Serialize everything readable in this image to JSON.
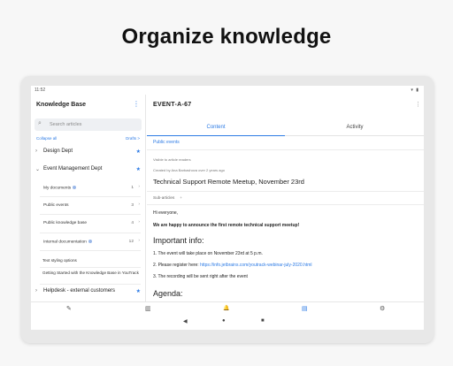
{
  "headline": "Organize knowledge",
  "status": {
    "time": "11:52",
    "icons": "▾ ▮"
  },
  "sidebar": {
    "title": "Knowledge Base",
    "menu_icon": "⋮",
    "search_placeholder": "Search articles",
    "collapse_all": "Collapse all",
    "drafts": "Drafts >",
    "items": [
      {
        "chevron": "›",
        "label": "Design Dept",
        "star": "★"
      },
      {
        "chevron": "⌄",
        "label": "Event Management Dept",
        "star": "★"
      }
    ],
    "sub_items": [
      {
        "label": "My documents",
        "count": "1",
        "arrow": "›",
        "dot": true
      },
      {
        "label": "Public events",
        "count": "3",
        "arrow": "›",
        "dot": false
      },
      {
        "label": "Public knowledge base",
        "count": "4",
        "arrow": "›",
        "dot": false
      },
      {
        "label": "Internal documentation",
        "count": "12",
        "arrow": "›",
        "dot": true
      }
    ],
    "flat_items": [
      {
        "label": "Text styling options"
      },
      {
        "label": "Getting Started with the Knowledge Base in YouTrack"
      }
    ],
    "last_item": {
      "chevron": "›",
      "label": "Helpdesk - external customers",
      "star": "★"
    }
  },
  "main": {
    "id": "EVENT-A-67",
    "more_icon": "⋮",
    "tabs": [
      {
        "label": "Content"
      },
      {
        "label": "Activity"
      }
    ],
    "visibility": "Public events",
    "visible_to": "Visible to article readers",
    "created_by": "Created by Ana Barbashova over 2 years ago",
    "title": "Technical Support Remote Meetup, November 23rd",
    "subarticles": "Sub-articles",
    "subarticles_plus": "+",
    "greeting": "Hi everyone,",
    "announce": "We are happy to announce the first remote technical support meetup!",
    "info_heading": "Important info:",
    "list": [
      {
        "num": "1.",
        "text": "The event will take place on November 23rd at 5 p.m."
      },
      {
        "num": "2.",
        "text": "Please register here: ",
        "link": "https://info.jetbrains.com/youtrack-webinar-july-2020.html"
      },
      {
        "num": "3.",
        "text": "The recording will be sent right after the event"
      }
    ],
    "agenda_heading": "Agenda:"
  },
  "bottom_bar": [
    {
      "icon": "✎",
      "name": "edit-icon",
      "active": false
    },
    {
      "icon": "▥",
      "name": "board-icon",
      "active": false
    },
    {
      "icon": "🔔",
      "name": "bell-icon",
      "active": false
    },
    {
      "icon": "▤",
      "name": "knowledge-base-icon",
      "active": true
    },
    {
      "icon": "⚙",
      "name": "settings-icon",
      "active": false
    }
  ],
  "nav_bar": [
    {
      "icon": "◀"
    },
    {
      "icon": "●"
    },
    {
      "icon": "■"
    }
  ],
  "colors": {
    "accent": "#2d7be5",
    "background": "#f7f7f7"
  }
}
